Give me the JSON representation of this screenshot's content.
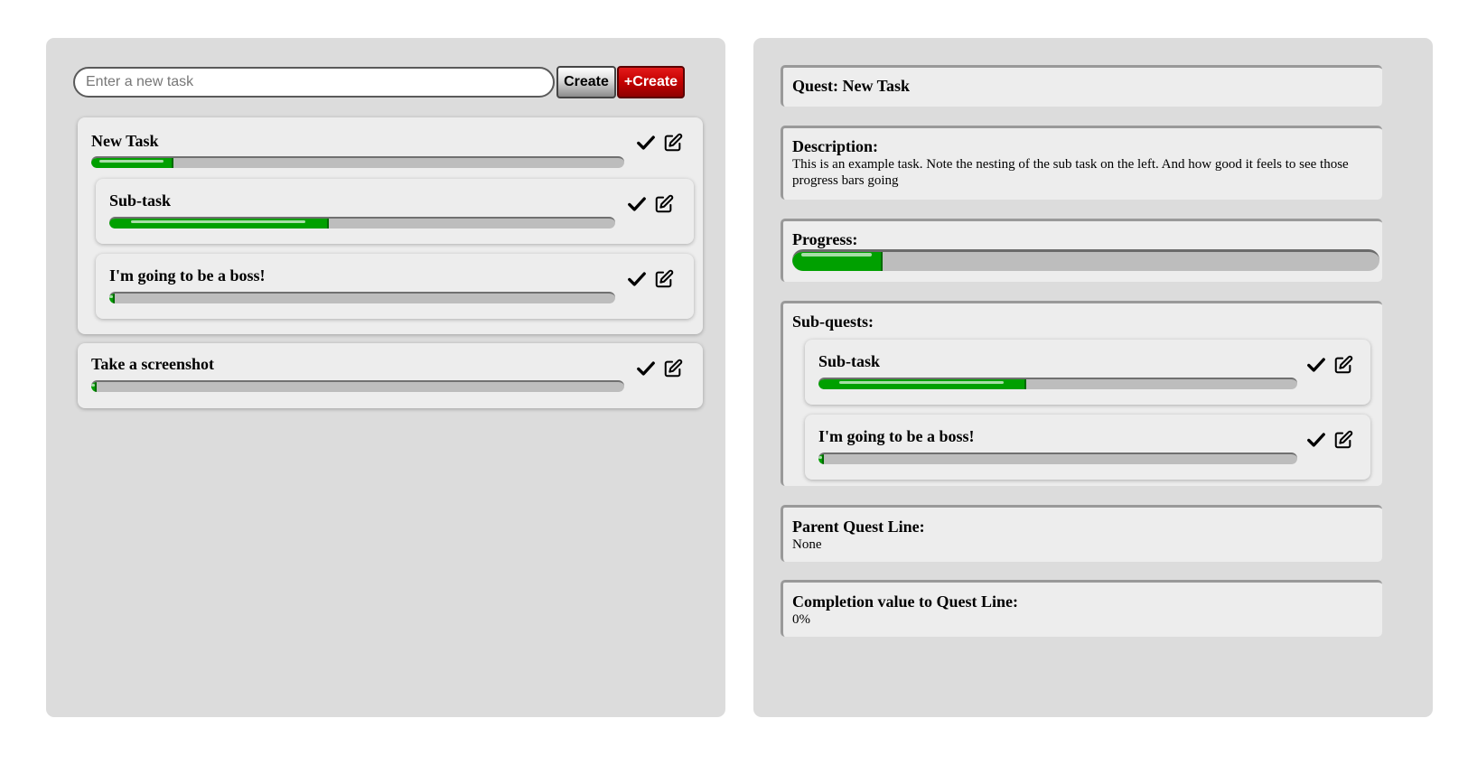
{
  "input": {
    "placeholder": "Enter a new task"
  },
  "buttons": {
    "create": "Create",
    "create_red": "+Create"
  },
  "tasks": [
    {
      "title": "New Task",
      "progress": 0.15,
      "subtasks": [
        {
          "title": "Sub-task",
          "progress": 0.43
        },
        {
          "title": "I'm going to be a boss!",
          "progress": 0.0
        }
      ]
    },
    {
      "title": "Take a screenshot",
      "progress": 0.0
    }
  ],
  "detail": {
    "quest_label": "Quest: New Task",
    "description_label": "Description:",
    "description": "This is an example task. Note the nesting of the sub task on the left. And how good it feels to see those progress bars going",
    "progress_label": "Progress:",
    "progress": 0.15,
    "subquests_label": "Sub-quests:",
    "subquests": [
      {
        "title": "Sub-task",
        "progress": 0.43
      },
      {
        "title": "I'm going to be a boss!",
        "progress": 0.0
      }
    ],
    "parent_label": "Parent Quest Line:",
    "parent_value": "None",
    "completion_label": "Completion value to Quest Line:",
    "completion_value": "0%"
  },
  "icons": {
    "complete": "checkmark-icon",
    "edit": "edit-icon"
  },
  "colors": {
    "progress_fill": "#00a000",
    "create_red": "#c40000",
    "panel_bg": "#dcdcdc"
  }
}
